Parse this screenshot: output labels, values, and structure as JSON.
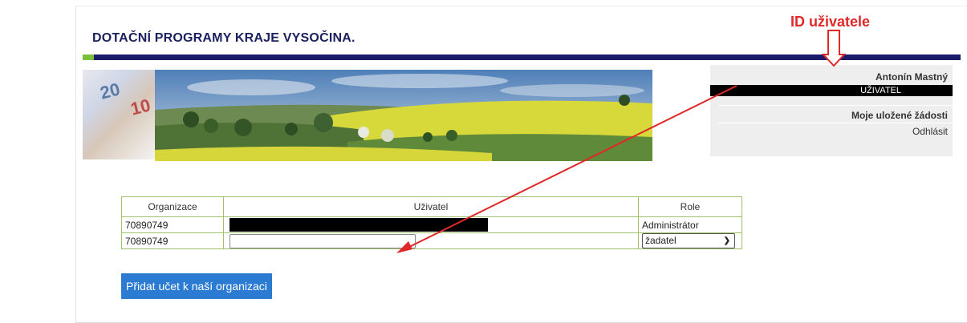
{
  "header": {
    "title": "DOTAČNÍ PROGRAMY KRAJE VYSOČINA."
  },
  "colors": {
    "accent_green": "#7bbf3a",
    "bar_blue": "#1c1a6b",
    "button_blue": "#2b7bd3",
    "annotation_red": "#e02828",
    "table_border": "#9cc36a"
  },
  "banner": {
    "money_note_1": "20",
    "money_note_2": "10"
  },
  "user_panel": {
    "name": "Antonín Mastný",
    "role": "UŽIVATEL",
    "saved_requests": "Moje uložené žádosti",
    "logout": "Odhlásit"
  },
  "table": {
    "headers": [
      "Organizace",
      "Uživatel",
      "Role"
    ],
    "rows": [
      {
        "org": "70890749",
        "role": "Administrátor"
      },
      {
        "org": "70890749",
        "role_select": "žadatel",
        "role_options": [
          "žadatel"
        ]
      }
    ]
  },
  "add_button": {
    "label": "Přidat učet k naší organizaci"
  },
  "annotation": {
    "label": "ID uživatele"
  },
  "icons": {
    "select_arrow": "chevron-down-icon"
  }
}
